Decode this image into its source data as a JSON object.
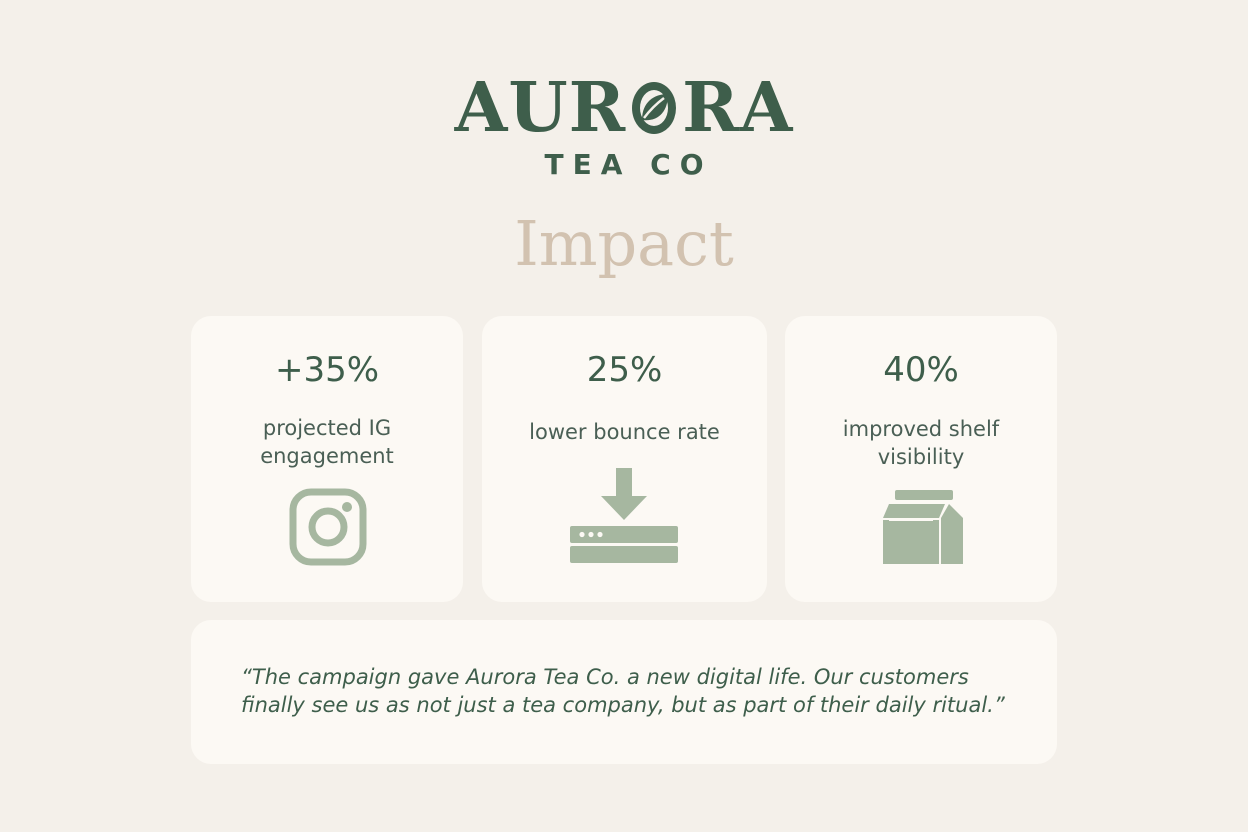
{
  "logo": {
    "word_left": "AUR",
    "word_right": "RA",
    "subtitle": "TEA CO"
  },
  "title": "Impact",
  "stats": [
    {
      "value": "+35%",
      "label": "projected IG engagement",
      "icon": "instagram-icon"
    },
    {
      "value": "25%",
      "label": "lower bounce rate",
      "icon": "download-server-icon"
    },
    {
      "value": "40%",
      "label": "improved shelf visibility",
      "icon": "tea-package-icon"
    }
  ],
  "quote": "“The campaign gave Aurora Tea Co. a new digital life. Our customers finally see us as not just a tea company, but as part of their daily ritual.”",
  "colors": {
    "brand_green": "#3e5e4b",
    "icon_sage": "#a6b7a0",
    "title_beige": "#d2c2b0",
    "card_bg": "#fcf9f4",
    "page_bg": "#f4f0ea"
  }
}
